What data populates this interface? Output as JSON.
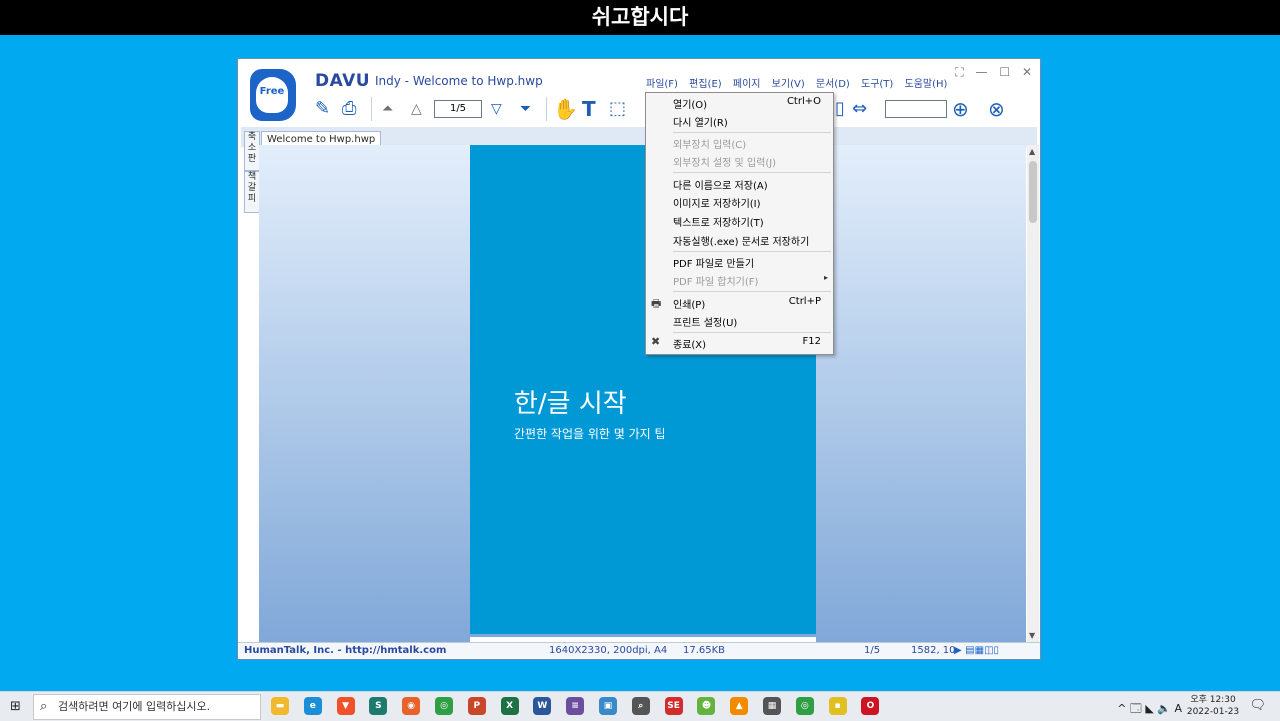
{
  "topbar": {
    "title": "쉬고합시다"
  },
  "app": {
    "logo_text": "Free",
    "brand": "DAVU",
    "title": "Indy - Welcome to Hwp.hwp",
    "menus": [
      "파일(F)",
      "편집(E)",
      "페이지",
      "보기(V)",
      "문서(D)",
      "도구(T)",
      "도움말(H)"
    ],
    "window_controls": {
      "fullscreen": "⛶",
      "minimize": "—",
      "maximize": "☐",
      "close": "✕"
    },
    "toolbar": {
      "page_indicator": "1/5",
      "search_value": ""
    },
    "tab": {
      "label": "Welcome to Hwp.hwp"
    },
    "side_tabs": [
      "축소판",
      "책갈피"
    ],
    "document": {
      "heading": "한/글 시작",
      "subheading": "간편한 작업을 위한 몇 가지 팁"
    },
    "status": {
      "company": "HumanTalk, Inc. - http://hmtalk.com",
      "dims": "1640X2330, 200dpi, A4",
      "size": "17.65KB",
      "page": "1/5",
      "coords": "1582, 10"
    }
  },
  "file_menu": {
    "items": [
      {
        "label": "열기(O)",
        "shortcut": "Ctrl+O",
        "disabled": false
      },
      {
        "label": "다시 열기(R)",
        "shortcut": "",
        "disabled": false
      },
      {
        "label": "외부장치 입력(C)",
        "shortcut": "",
        "disabled": true
      },
      {
        "label": "외부장치 설정 및 입력(J)",
        "shortcut": "",
        "disabled": true
      },
      {
        "label": "다른 이름으로 저장(A)",
        "shortcut": "",
        "disabled": false
      },
      {
        "label": "이미지로 저장하기(I)",
        "shortcut": "",
        "disabled": false
      },
      {
        "label": "텍스트로 저장하기(T)",
        "shortcut": "",
        "disabled": false
      },
      {
        "label": "자동실행(.exe) 문서로 저장하기",
        "shortcut": "",
        "disabled": false
      },
      {
        "label": "PDF 파일로 만들기",
        "shortcut": "",
        "disabled": false
      },
      {
        "label": "PDF 파일 합치기(F)",
        "shortcut": "",
        "disabled": true,
        "submenu_arrow": "▸"
      },
      {
        "label": "인쇄(P)",
        "shortcut": "Ctrl+P",
        "disabled": false,
        "icon": "printer-icon"
      },
      {
        "label": "프린트 설정(U)",
        "shortcut": "",
        "disabled": false
      },
      {
        "label": "종료(X)",
        "shortcut": "F12",
        "disabled": false,
        "icon": "close-x-icon"
      }
    ]
  },
  "taskbar": {
    "search_placeholder": "검색하려면 여기에 입력하십시오.",
    "apps": [
      {
        "name": "file-explorer",
        "color": "#f2b92f",
        "glyph": "▬"
      },
      {
        "name": "edge",
        "color": "#1b8fd6",
        "glyph": "e"
      },
      {
        "name": "brave",
        "color": "#f0502a",
        "glyph": "▼"
      },
      {
        "name": "app-s",
        "color": "#1f7a6e",
        "glyph": "S"
      },
      {
        "name": "firefox",
        "color": "#e8632a",
        "glyph": "◉"
      },
      {
        "name": "chrome",
        "color": "#2f9e45",
        "glyph": "◎"
      },
      {
        "name": "powerpoint",
        "color": "#c8472b",
        "glyph": "P"
      },
      {
        "name": "excel",
        "color": "#1e7145",
        "glyph": "X"
      },
      {
        "name": "word",
        "color": "#2b579a",
        "glyph": "W"
      },
      {
        "name": "calc-app",
        "color": "#6b4f9e",
        "glyph": "≡"
      },
      {
        "name": "display-app",
        "color": "#3a89c9",
        "glyph": "▣"
      },
      {
        "name": "search-app",
        "color": "#555555",
        "glyph": "⌕"
      },
      {
        "name": "se-app",
        "color": "#d22d2d",
        "glyph": "SE"
      },
      {
        "name": "green-app",
        "color": "#64b33c",
        "glyph": "☻"
      },
      {
        "name": "vlc",
        "color": "#f28a00",
        "glyph": "▲"
      },
      {
        "name": "calculator",
        "color": "#555555",
        "glyph": "▦"
      },
      {
        "name": "chrome-dev",
        "color": "#2f9e45",
        "glyph": "◎"
      },
      {
        "name": "sticky-notes",
        "color": "#e0c020",
        "glyph": "▪"
      },
      {
        "name": "opera",
        "color": "#cc1424",
        "glyph": "O"
      }
    ],
    "tray_icons": "^ 🗔 ◣ 🔈 A",
    "time": "오후 12:30",
    "date": "2022-01-23"
  }
}
